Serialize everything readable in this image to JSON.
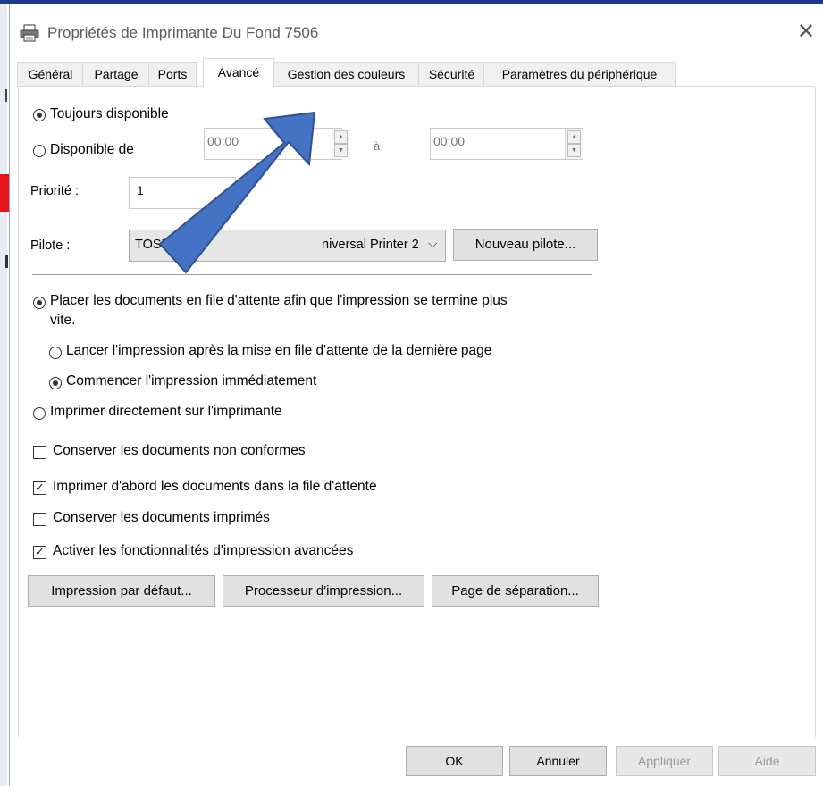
{
  "window": {
    "title": "Propriétés de Imprimante Du Fond 7506",
    "close_glyph": "✕",
    "title_icon": "printer-icon"
  },
  "tabs": [
    {
      "label": "Général",
      "active": false
    },
    {
      "label": "Partage",
      "active": false
    },
    {
      "label": "Ports",
      "active": false
    },
    {
      "label": "Avancé",
      "active": true
    },
    {
      "label": "Gestion des couleurs",
      "active": false
    },
    {
      "label": "Sécurité",
      "active": false
    },
    {
      "label": "Paramètres du périphérique",
      "active": false
    }
  ],
  "availability": {
    "always_label": "Toujours disponible",
    "always_selected": true,
    "from_label": "Disponible de",
    "from_selected": false,
    "from_time": "00:00",
    "to_label": "à",
    "to_time": "00:00"
  },
  "priority": {
    "label": "Priorité :",
    "value": "1"
  },
  "driver": {
    "label": "Pilote :",
    "value": "TOSHIBA Universal Printer 2",
    "visible_value_left": "TOSHIB",
    "visible_value_right": "niversal Printer 2",
    "new_button": "Nouveau pilote..."
  },
  "spooling": {
    "spool_label_line1": "Placer les documents en file d'attente afin que l'impression se termine plus",
    "spool_label_line2": "vite.",
    "spool_selected": true,
    "after_last_page_label": "Lancer l'impression après la mise en file d'attente de la dernière page",
    "after_last_page_selected": false,
    "immediately_label": "Commencer l'impression immédiatement",
    "immediately_selected": true,
    "direct_label": "Imprimer directement sur l'imprimante",
    "direct_selected": false
  },
  "options": [
    {
      "label": "Conserver les documents non conformes",
      "checked": false
    },
    {
      "label": "Imprimer d'abord les documents dans la file d'attente",
      "checked": true
    },
    {
      "label": "Conserver les documents imprimés",
      "checked": false
    },
    {
      "label": "Activer les fonctionnalités d'impression avancées",
      "checked": true
    }
  ],
  "bottom_buttons": {
    "defaults": "Impression par défaut...",
    "processor": "Processeur d'impression...",
    "separator": "Page de séparation..."
  },
  "footer": {
    "ok": "OK",
    "cancel": "Annuler",
    "apply": "Appliquer",
    "help": "Aide"
  },
  "colors": {
    "annotation_arrow": "#4472c4",
    "annotation_arrow_border": "#2f528f"
  }
}
